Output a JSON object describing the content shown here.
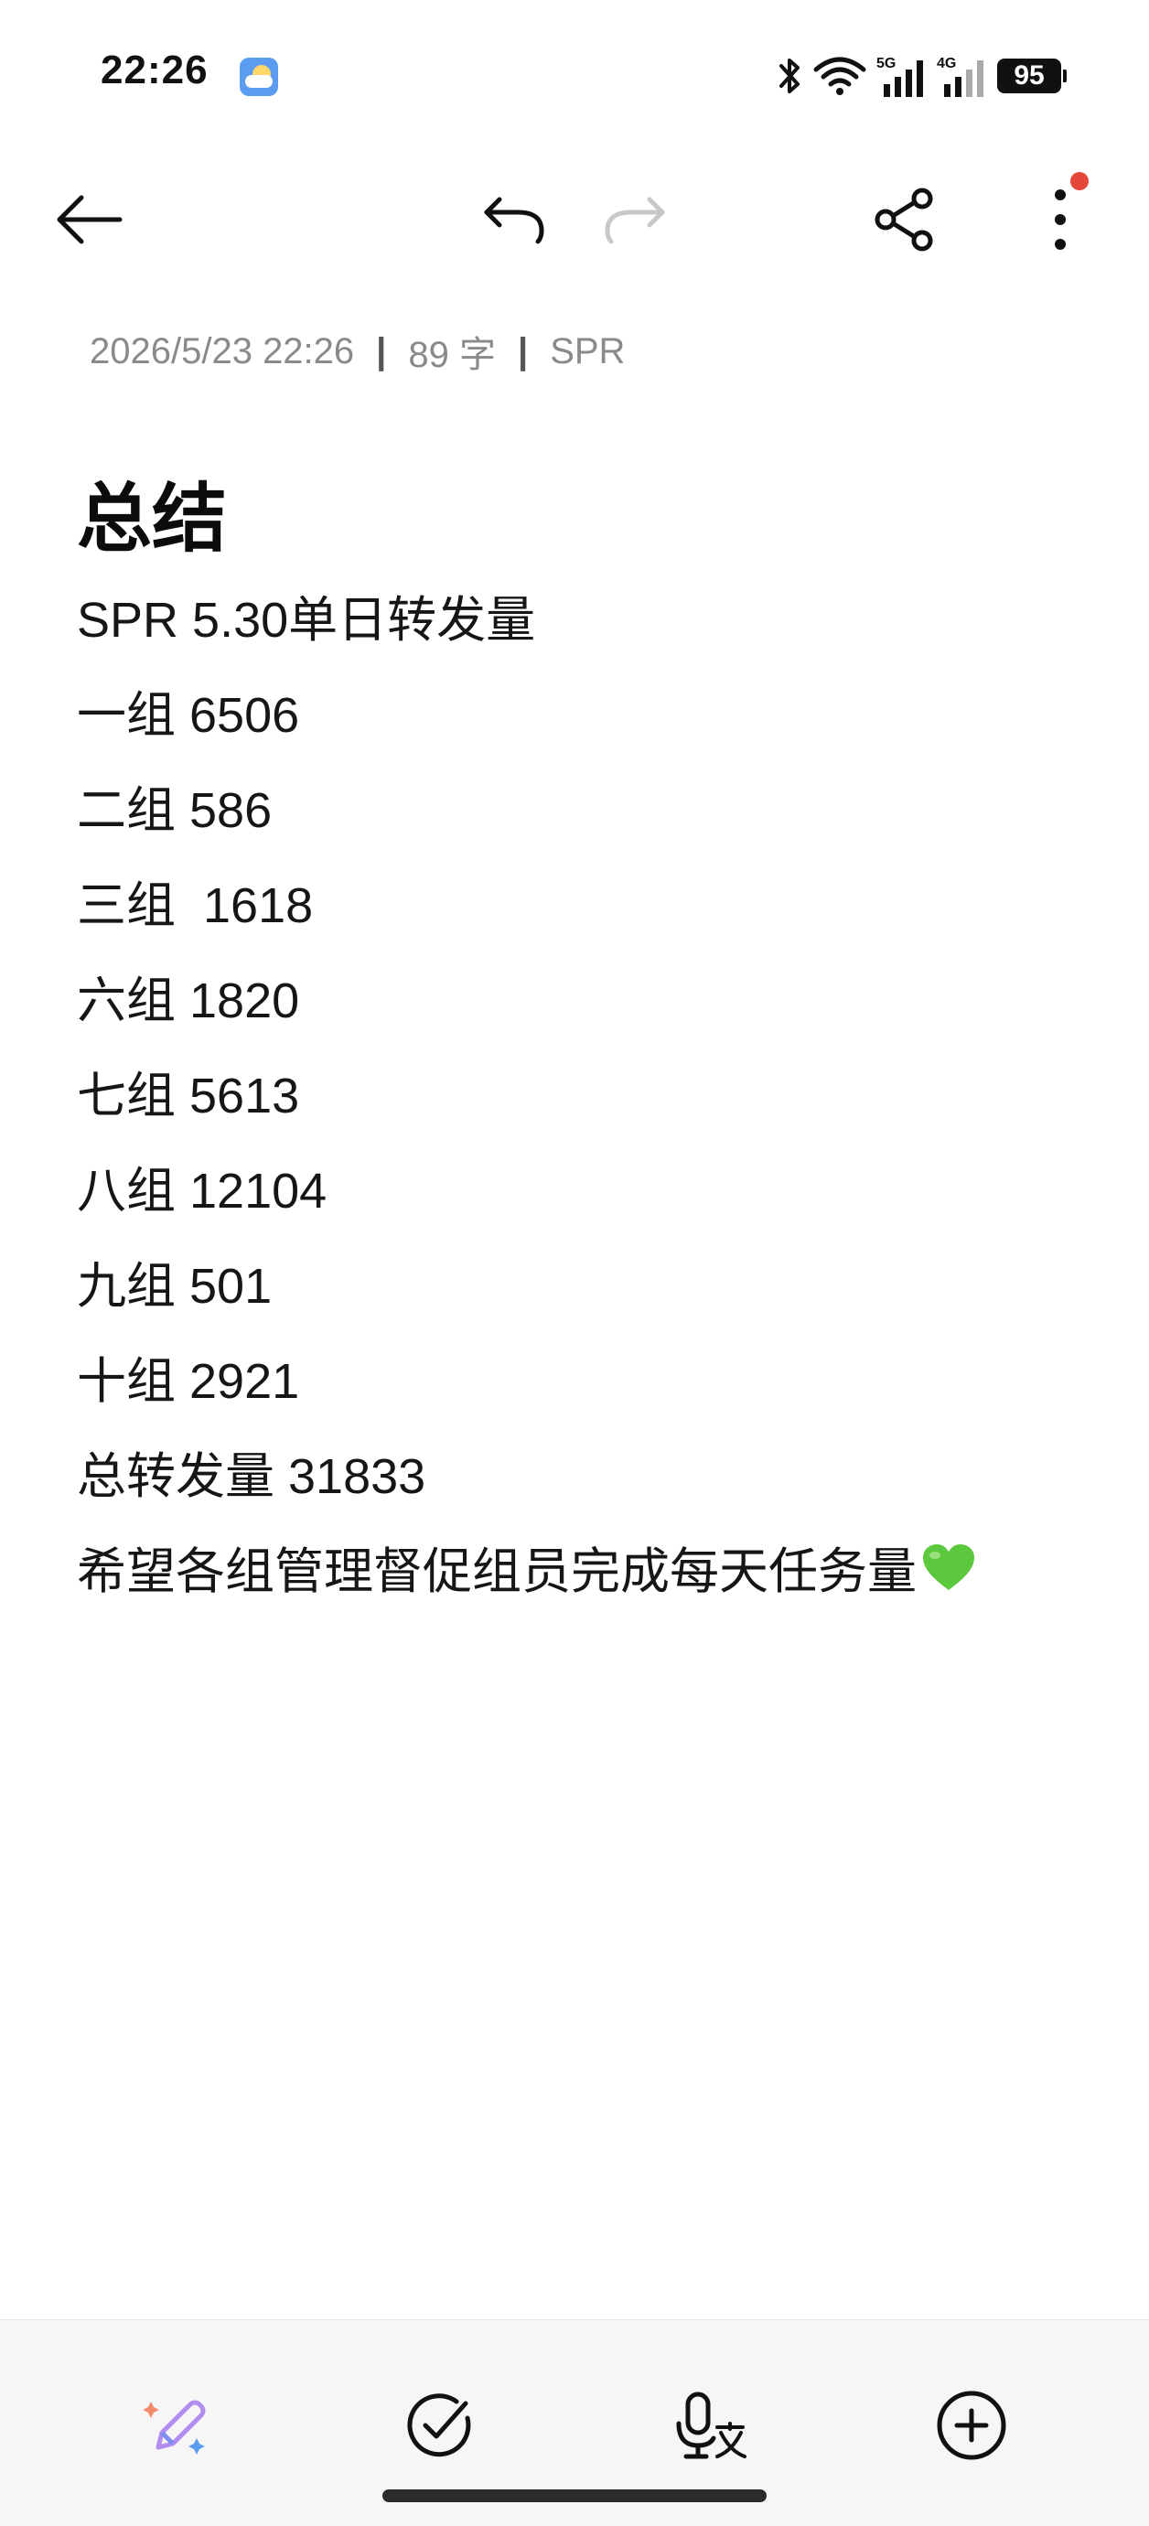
{
  "status_bar": {
    "time": "22:26",
    "battery": "95",
    "network_1": "5G",
    "network_2": "4G",
    "icons": [
      "weather-icon",
      "bluetooth-icon",
      "wifi-icon",
      "signal-5g-icon",
      "signal-4g-icon",
      "battery-icon"
    ]
  },
  "toolbar": {
    "icons": [
      "back-arrow-icon",
      "undo-icon",
      "redo-icon",
      "share-icon",
      "more-vertical-icon"
    ],
    "redo_disabled": true,
    "notification_dot_color": "#e5483a"
  },
  "meta": {
    "datetime": "2026/5/23 22:26",
    "char_count": "89 字",
    "folder": "SPR"
  },
  "note": {
    "title": "总结",
    "lines": [
      "SPR 5.30单日转发量",
      "一组 6506",
      "二组 586",
      "三组  1618",
      "六组 1820",
      "七组 5613",
      "八组 12104",
      "九组 501",
      "十组 2921",
      "总转发量 31833",
      "希望各组管理督促组员完成每天任务量"
    ],
    "trailing_emoji": "green-heart-icon"
  },
  "bottom_bar": {
    "icons": [
      "ai-pen-icon",
      "checklist-icon",
      "voice-to-text-icon",
      "add-circle-icon"
    ]
  },
  "colors": {
    "text": "#161616",
    "meta_text": "#8a8a8a",
    "heart": "#5cc83d",
    "bottom_bar_bg": "#f6f6f6"
  }
}
